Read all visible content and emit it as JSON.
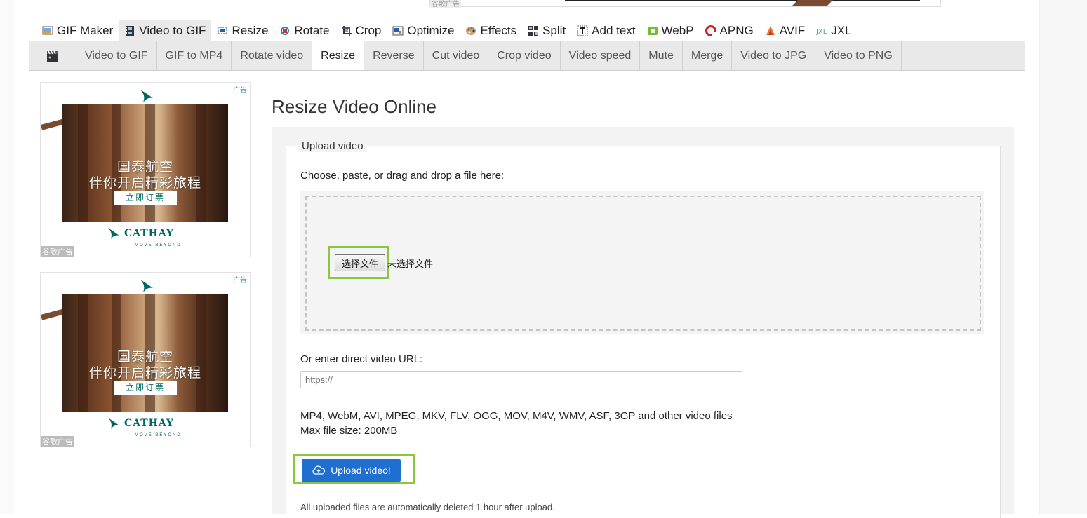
{
  "top_ad": {
    "tag": "谷歌广告"
  },
  "main_nav": [
    {
      "label": "GIF Maker",
      "icon": "gif-maker-icon"
    },
    {
      "label": "Video to GIF",
      "icon": "film-strip-icon",
      "active": true
    },
    {
      "label": "Resize",
      "icon": "resize-icon"
    },
    {
      "label": "Rotate",
      "icon": "rotate-icon"
    },
    {
      "label": "Crop",
      "icon": "crop-icon"
    },
    {
      "label": "Optimize",
      "icon": "optimize-icon"
    },
    {
      "label": "Effects",
      "icon": "palette-icon"
    },
    {
      "label": "Split",
      "icon": "split-icon"
    },
    {
      "label": "Add text",
      "icon": "text-icon"
    },
    {
      "label": "WebP",
      "icon": "webp-icon"
    },
    {
      "label": "APNG",
      "icon": "apng-icon"
    },
    {
      "label": "AVIF",
      "icon": "avif-icon"
    },
    {
      "label": "JXL",
      "icon": "jxl-icon"
    }
  ],
  "sub_nav": {
    "icon": "clapperboard-icon",
    "items": [
      {
        "label": "Video to GIF"
      },
      {
        "label": "GIF to MP4"
      },
      {
        "label": "Rotate video"
      },
      {
        "label": "Resize",
        "active": true
      },
      {
        "label": "Reverse"
      },
      {
        "label": "Cut video"
      },
      {
        "label": "Crop video"
      },
      {
        "label": "Video speed"
      },
      {
        "label": "Mute"
      },
      {
        "label": "Merge"
      },
      {
        "label": "Video to JPG"
      },
      {
        "label": "Video to PNG"
      }
    ]
  },
  "ads": [
    {
      "ad_label": "广告",
      "line1": "国泰航空",
      "line2": "伴你开启精彩旅程",
      "cta": "立即订票",
      "brand": "CATHAY",
      "tagline": "MOVE BEYOND",
      "footer": "谷歌广告"
    },
    {
      "ad_label": "广告",
      "line1": "国泰航空",
      "line2": "伴你开启精彩旅程",
      "cta": "立即订票",
      "brand": "CATHAY",
      "tagline": "MOVE BEYOND",
      "footer": "谷歌广告"
    }
  ],
  "page": {
    "title": "Resize Video Online",
    "legend": "Upload video",
    "choose_label": "Choose, paste, or drag and drop a file here:",
    "file_button": "选择文件",
    "file_status": "未选择文件",
    "url_label": "Or enter direct video URL:",
    "url_placeholder": "https://",
    "formats": "MP4, WebM, AVI, MPEG, MKV, FLV, OGG, MOV, M4V, WMV, ASF, 3GP and other video files",
    "max_size": "Max file size: 200MB",
    "upload_button": "Upload video!",
    "note": "All uploaded files are automatically deleted 1 hour after upload."
  },
  "colors": {
    "highlight": "#8cc63f",
    "upload_button": "#1f6fd1",
    "nav_bg": "#e9e9e9",
    "brand": "#006564"
  }
}
